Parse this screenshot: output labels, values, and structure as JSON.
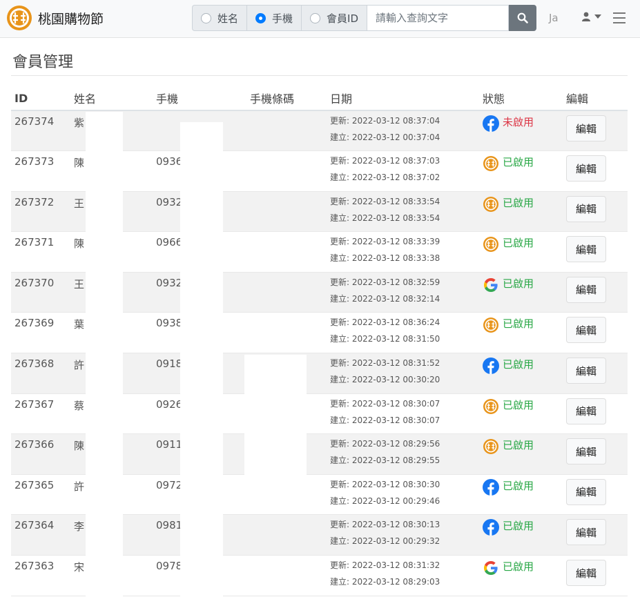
{
  "brand": {
    "name": "桃園購物節"
  },
  "search": {
    "options": [
      {
        "label": "姓名",
        "checked": false
      },
      {
        "label": "手機",
        "checked": true
      },
      {
        "label": "會員ID",
        "checked": false
      }
    ],
    "placeholder": "請輸入查詢文字"
  },
  "user": {
    "name": "Ja"
  },
  "page": {
    "title": "會員管理"
  },
  "table": {
    "headers": {
      "id": "ID",
      "name": "姓名",
      "phone": "手機",
      "barcode": "手機條碼",
      "date": "日期",
      "status": "狀態",
      "edit": "編輯"
    },
    "updated_prefix": "更新: ",
    "created_prefix": "建立: ",
    "edit_label": "編輯",
    "rows": [
      {
        "id": "267374",
        "name": "紫",
        "phone": "",
        "updated": "2022-03-12 08:37:04",
        "created": "2022-03-12 00:37:04",
        "provider": "facebook",
        "status": "未啟用"
      },
      {
        "id": "267373",
        "name": "陳",
        "phone": "0936",
        "updated": "2022-03-12 08:37:03",
        "created": "2022-03-12 08:37:02",
        "provider": "site",
        "status": "已啟用"
      },
      {
        "id": "267372",
        "name": "王",
        "phone": "0932",
        "updated": "2022-03-12 08:33:54",
        "created": "2022-03-12 08:33:54",
        "provider": "site",
        "status": "已啟用"
      },
      {
        "id": "267371",
        "name": "陳",
        "phone": "0966",
        "updated": "2022-03-12 08:33:39",
        "created": "2022-03-12 08:33:38",
        "provider": "site",
        "status": "已啟用"
      },
      {
        "id": "267370",
        "name": "王",
        "phone": "0932",
        "updated": "2022-03-12 08:32:59",
        "created": "2022-03-12 08:32:14",
        "provider": "google",
        "status": "已啟用"
      },
      {
        "id": "267369",
        "name": "葉",
        "phone": "0938",
        "updated": "2022-03-12 08:36:24",
        "created": "2022-03-12 08:31:50",
        "provider": "site",
        "status": "已啟用"
      },
      {
        "id": "267368",
        "name": "許",
        "phone": "0918",
        "updated": "2022-03-12 08:31:52",
        "created": "2022-03-12 00:30:20",
        "provider": "facebook",
        "status": "已啟用"
      },
      {
        "id": "267367",
        "name": "蔡",
        "phone": "0926",
        "updated": "2022-03-12 08:30:07",
        "created": "2022-03-12 08:30:07",
        "provider": "site",
        "status": "已啟用"
      },
      {
        "id": "267366",
        "name": "陳",
        "phone": "0911",
        "updated": "2022-03-12 08:29:56",
        "created": "2022-03-12 08:29:55",
        "provider": "site",
        "status": "已啟用"
      },
      {
        "id": "267365",
        "name": "許",
        "phone": "0972",
        "updated": "2022-03-12 08:30:30",
        "created": "2022-03-12 00:29:46",
        "provider": "facebook",
        "status": "已啟用"
      },
      {
        "id": "267364",
        "name": "李",
        "phone": "0981",
        "updated": "2022-03-12 08:30:13",
        "created": "2022-03-12 00:29:32",
        "provider": "facebook",
        "status": "已啟用"
      },
      {
        "id": "267363",
        "name": "宋",
        "phone": "0978",
        "updated": "2022-03-12 08:31:32",
        "created": "2022-03-12 08:29:03",
        "provider": "google",
        "status": "已啟用"
      }
    ]
  },
  "colors": {
    "active": "#28a745",
    "inactive": "#dc3545",
    "primary": "#007bff",
    "facebook": "#1877f2",
    "site_logo": "#e8941a"
  }
}
